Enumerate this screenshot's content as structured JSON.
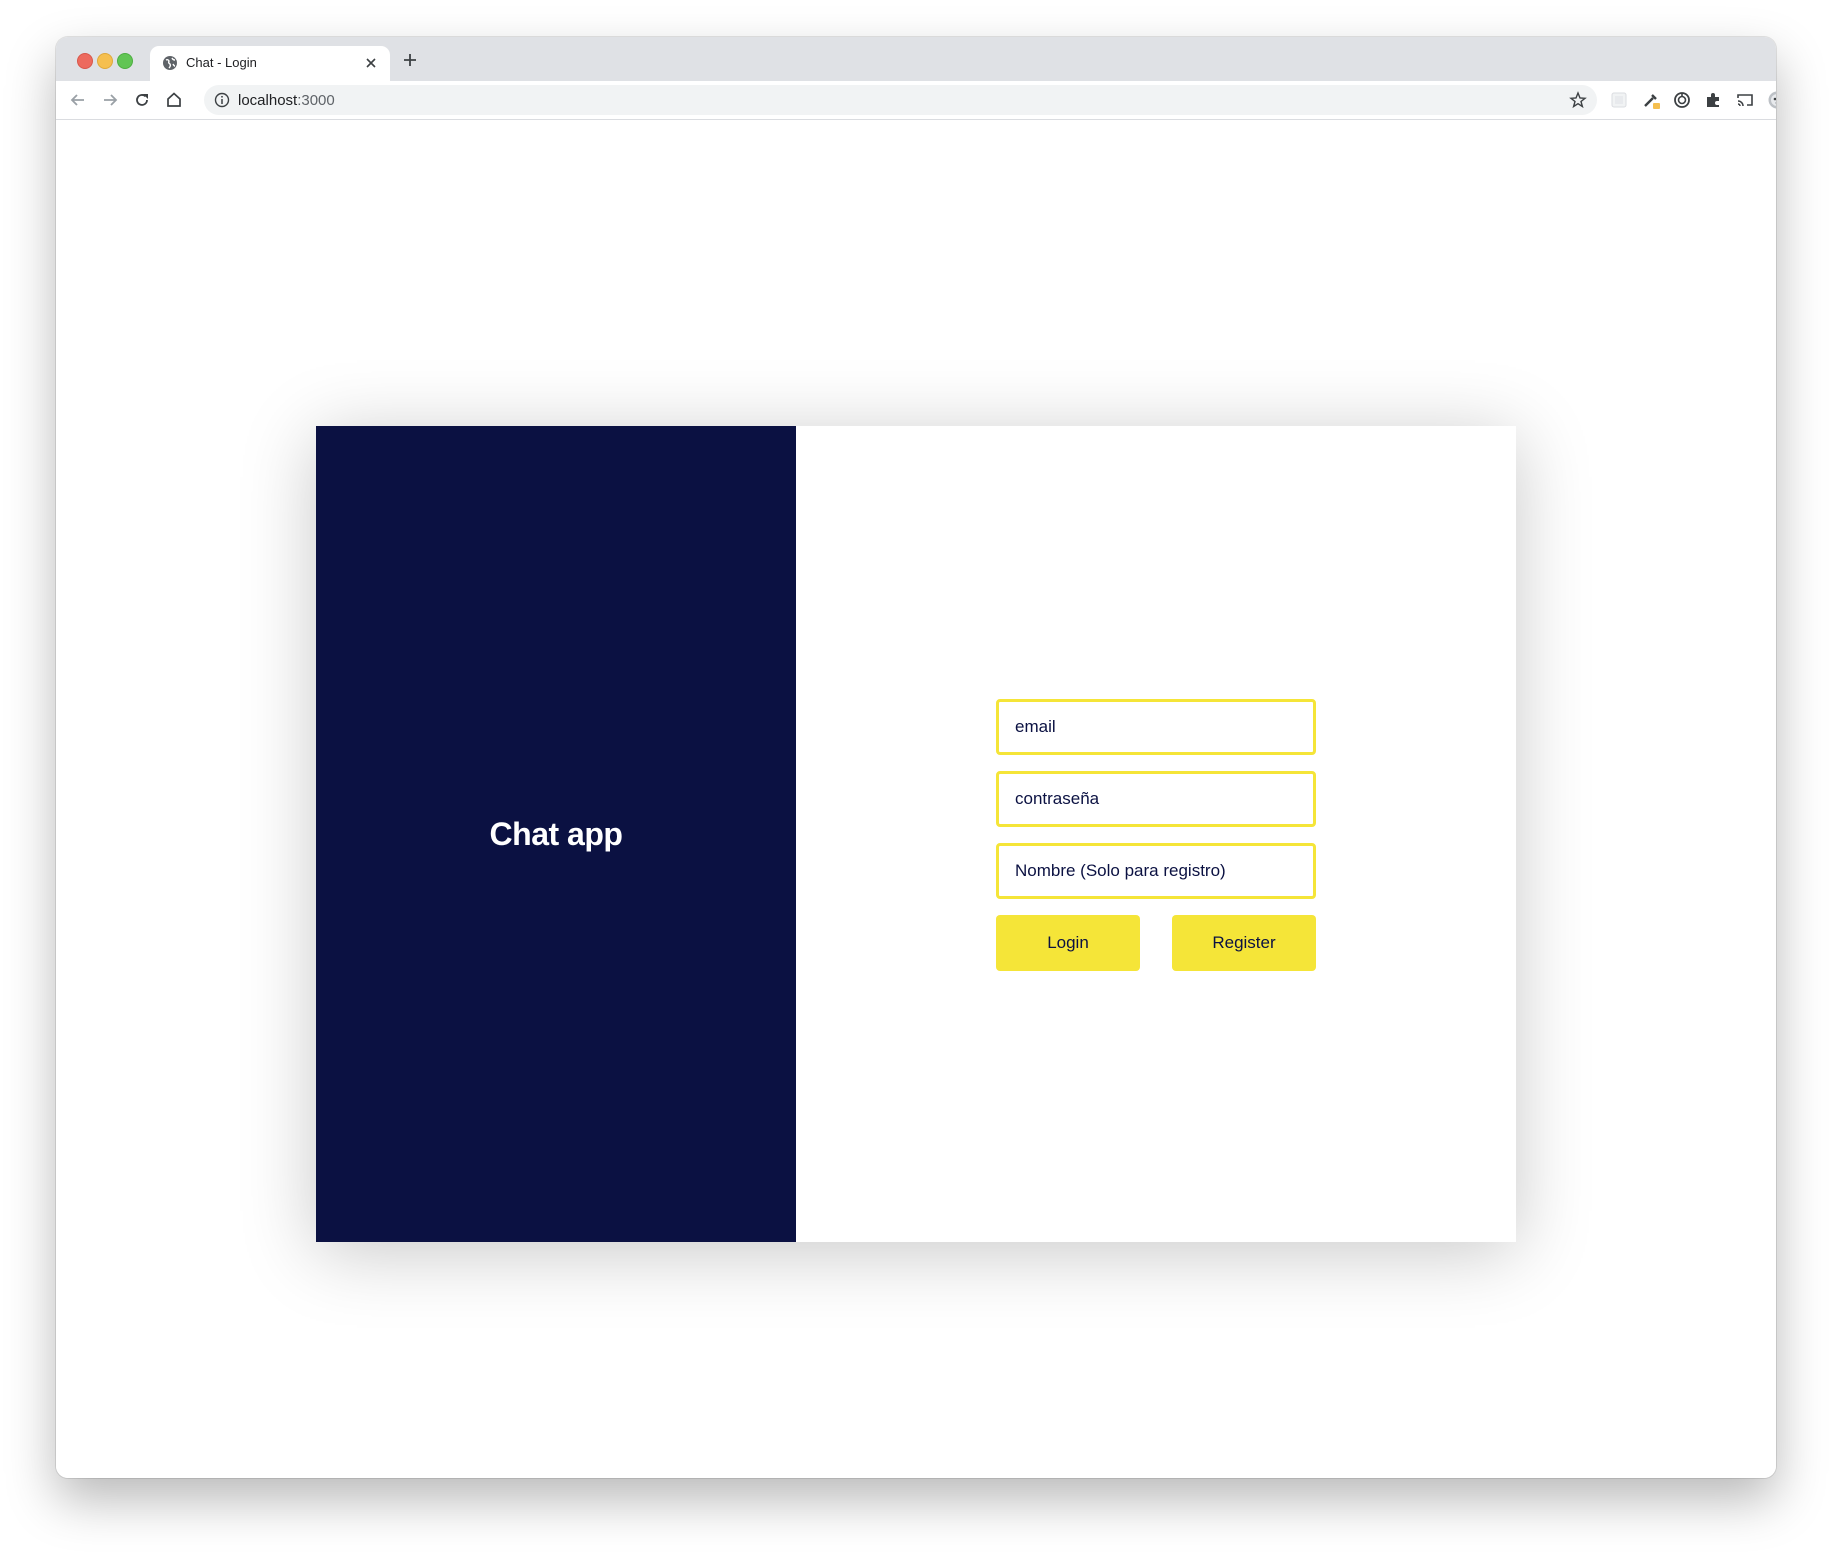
{
  "browser": {
    "tab_title": "Chat - Login",
    "url_host": "localhost",
    "url_port": ":3000"
  },
  "app": {
    "title": "Chat app",
    "fields": {
      "email_placeholder": "email",
      "password_placeholder": "contraseña",
      "name_placeholder": "Nombre (Solo para registro)"
    },
    "buttons": {
      "login": "Login",
      "register": "Register"
    }
  },
  "colors": {
    "brand_panel": "#0b1142",
    "accent": "#f5e538",
    "text": "#0b1142"
  },
  "icons": [
    "globe-icon",
    "close-icon",
    "plus-icon",
    "back-icon",
    "forward-icon",
    "reload-icon",
    "home-icon",
    "info-icon",
    "star-icon",
    "extension-icon",
    "eyedropper-icon",
    "history-icon",
    "puzzle-icon",
    "cast-icon",
    "profile-icon",
    "more-icon"
  ]
}
